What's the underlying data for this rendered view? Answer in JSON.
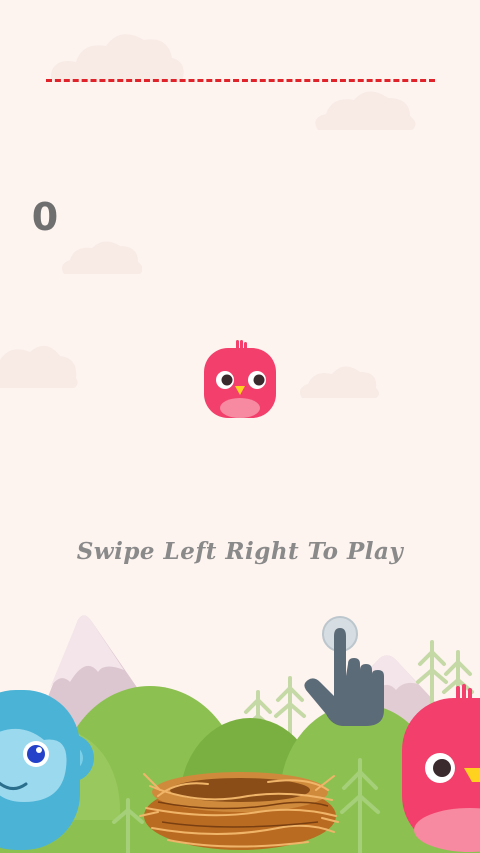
{
  "score": "0",
  "instruction": "Swipe Left Right To Play",
  "icons": {
    "player": "pink-bird-icon",
    "tutorial": "swipe-hand-icon",
    "nest": "nest-icon",
    "left_character": "blue-monkey-icon",
    "right_character": "pink-bird-icon"
  },
  "colors": {
    "background": "#fdf3ef",
    "limit_line": "#e0222a",
    "bird": "#f23f6b",
    "text": "#8a8a8a",
    "hills": "#8cc152"
  }
}
